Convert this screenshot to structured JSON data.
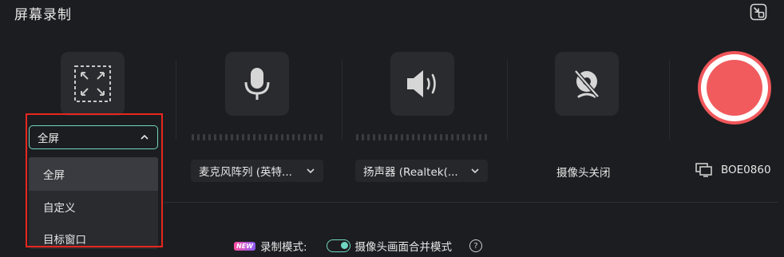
{
  "window": {
    "title": "屏幕录制"
  },
  "region": {
    "selected": "全屏",
    "options": [
      "全屏",
      "自定义",
      "目标窗口"
    ]
  },
  "microphone": {
    "device": "麦克风阵列 (英特..."
  },
  "speaker": {
    "device": "扬声器 (Realtek(..."
  },
  "camera": {
    "status": "摄像头关闭"
  },
  "monitor": {
    "label": "BOE0860"
  },
  "bottom": {
    "badge": "NEW",
    "record_mode_label": "录制模式:",
    "merge_label": "摄像头画面合并模式",
    "help": "?"
  },
  "icons": {
    "region": "fullscreen-select-icon",
    "mic": "microphone-icon",
    "speaker": "speaker-icon",
    "camera": "camera-off-icon",
    "monitor": "monitor-icon",
    "minimize": "exit-window-icon"
  },
  "colors": {
    "accent": "#6fd6c1",
    "record": "#f15b5d",
    "highlight": "#e8261f",
    "background": "#1c1d20"
  }
}
